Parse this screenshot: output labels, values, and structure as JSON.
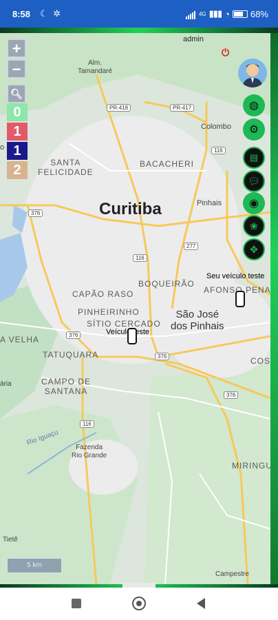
{
  "status": {
    "time": "8:58",
    "battery": "68%",
    "network": "4G"
  },
  "map": {
    "zoom_in": "+",
    "zoom_out": "−",
    "user": "admin",
    "scale": "5 km",
    "counters": [
      {
        "value": "0",
        "color": "#8ee6a8"
      },
      {
        "value": "1",
        "color": "#e35a6a"
      },
      {
        "value": "1",
        "color": "#1a1a8c"
      },
      {
        "value": "2",
        "color": "#d7b48e"
      }
    ],
    "places": {
      "curitiba": "Curitiba",
      "sao_jose": "São José\ndos Pinhais",
      "alm_tamandare": "Alm.\nTamandaré",
      "colombo": "Colombo",
      "bacacheri": "BACACHERI",
      "santa_felicidade": "SANTA\nFELICIDADE",
      "magro": "o Magro",
      "pinhais": "Pinhais",
      "capao_raso": "CAPÃO RASO",
      "boqueirao": "BOQUEIRÃO",
      "pinheirinho": "PINHEIRINHO",
      "sitio_cercado": "SÍTIO CERCADO",
      "afonso_pena": "AFONSO PENA",
      "velha": "A VELHA",
      "tatuquara": "TATUQUARA",
      "campo_santana": "CAMPO DE\nSANTANA",
      "costa": "COST",
      "aria": "ária",
      "fazenda": "Fazenda\nRio Grande",
      "miringu": "MIRINGU",
      "rio_iguacu": "Rio Iguaçu",
      "tiete": "Tietê",
      "campestre": "Campestre",
      "br376a": "376",
      "br376b": "376",
      "br376c": "376",
      "br376d": "376",
      "br116a": "116",
      "br116b": "116",
      "br116c": "116",
      "pr418": "PR-418",
      "pr417": "PR-417",
      "r277": "277"
    },
    "vehicles": [
      {
        "label": "Seu veículo teste"
      },
      {
        "label": "Veículo teste"
      }
    ]
  }
}
